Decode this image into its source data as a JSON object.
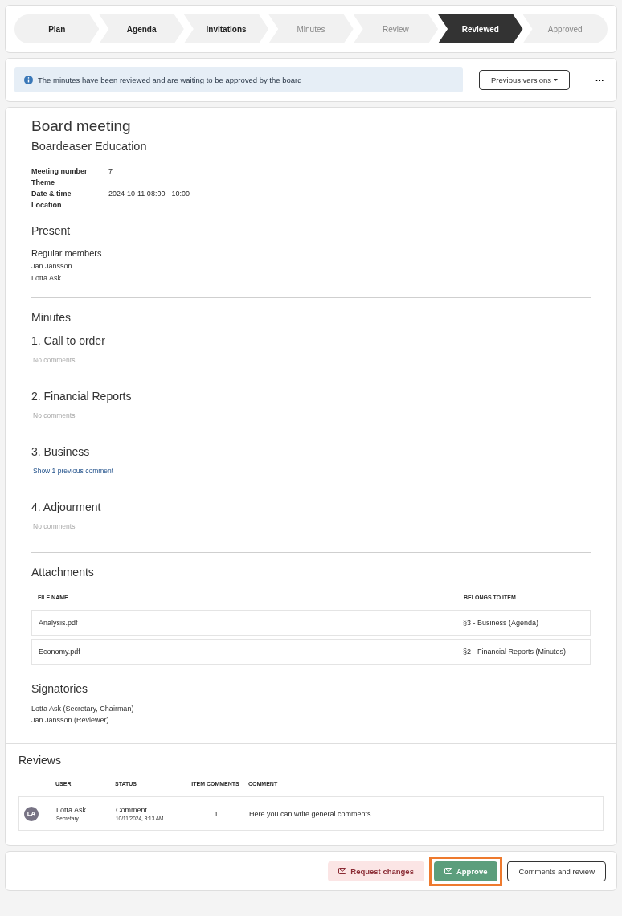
{
  "steps": [
    {
      "label": "Plan",
      "done": true,
      "selected": false
    },
    {
      "label": "Agenda",
      "done": true,
      "selected": false
    },
    {
      "label": "Invitations",
      "done": true,
      "selected": false
    },
    {
      "label": "Minutes",
      "done": false,
      "selected": false
    },
    {
      "label": "Review",
      "done": false,
      "selected": false
    },
    {
      "label": "Reviewed",
      "done": true,
      "selected": true
    },
    {
      "label": "Approved",
      "done": false,
      "selected": false
    }
  ],
  "notice": {
    "text": "The minutes have been reviewed and are waiting to be approved by the board",
    "previous_versions": "Previous versions",
    "more": "···"
  },
  "meeting": {
    "title": "Board meeting",
    "organization": "Boardeaser Education",
    "details": [
      {
        "label": "Meeting number",
        "value": "7"
      },
      {
        "label": "Theme"
      },
      {
        "label": "Date & time",
        "value": "2024-10-11 08:00 - 10:00"
      },
      {
        "label": "Location"
      }
    ],
    "present": {
      "heading": "Present",
      "groups": [
        {
          "name": "Regular members",
          "people": [
            "Jan Jansson",
            "Lotta Ask"
          ]
        }
      ]
    }
  },
  "minutes": {
    "heading": "Minutes",
    "items": [
      {
        "title": "1. Call to order",
        "kind": "empty",
        "note": "No comments"
      },
      {
        "title": "2. Financial Reports",
        "kind": "empty",
        "note": "No comments"
      },
      {
        "title": "3. Business",
        "kind": "link",
        "note": "Show 1 previous comment"
      },
      {
        "title": "4. Adjourment",
        "kind": "empty",
        "note": "No comments"
      }
    ]
  },
  "attachments": {
    "heading": "Attachments",
    "columns": [
      "FILE NAME",
      "BELONGS TO ITEM"
    ],
    "rows": [
      [
        "Analysis.pdf",
        "§3 - Business (Agenda)"
      ],
      [
        "Economy.pdf",
        "§2 - Financial Reports (Minutes)"
      ]
    ]
  },
  "signatories": {
    "heading": "Signatories",
    "people": [
      "Lotta Ask (Secretary, Chairman)",
      "Jan Jansson (Reviewer)"
    ]
  },
  "reviews": {
    "heading": "Reviews",
    "columns": [
      "USER",
      "STATUS",
      "ITEM COMMENTS",
      "COMMENT"
    ],
    "rows": [
      {
        "initials": "LA",
        "name": "Lotta Ask",
        "role": "Secretary",
        "status": "Comment",
        "date": "10/11/2024, 8:13 AM",
        "item_comments": "1",
        "comment": "Here you can write general comments."
      }
    ]
  },
  "actions": [
    {
      "label": "Request changes",
      "kind": "danger",
      "highlighted": false
    },
    {
      "label": "Approve",
      "kind": "primary",
      "highlighted": true
    },
    {
      "label": "Comments and review",
      "kind": "outline",
      "highlighted": false
    }
  ]
}
